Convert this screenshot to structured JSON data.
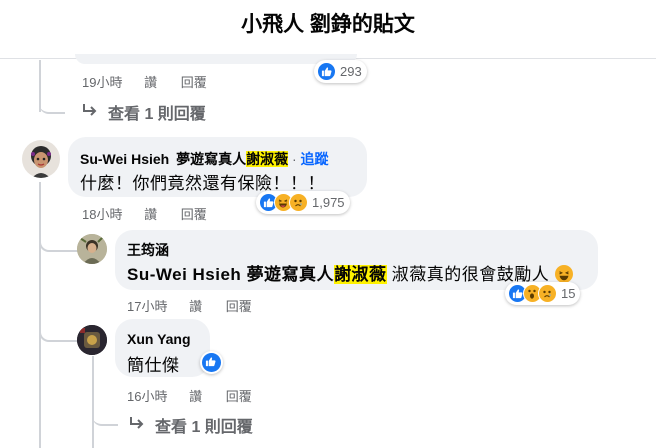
{
  "header": {
    "title": "小飛人 劉錚的貼文"
  },
  "comments": [
    {
      "time": "19小時",
      "like_label": "讚",
      "reply_label": "回覆",
      "reaction_count": "293",
      "view_replies": "查看 1 則回覆"
    },
    {
      "author": "Su-Wei Hsieh",
      "mention_prefix": "夢遊寫真人",
      "mention_highlight": "謝淑薇",
      "separator": "·",
      "follow_label": "追蹤",
      "text": "什麼！你們竟然還有保險！！！",
      "time": "18小時",
      "like_label": "讚",
      "reply_label": "回覆",
      "reaction_count": "1,975"
    },
    {
      "author": "王筠涵",
      "mention_name": "Su-Wei Hsieh",
      "mention_prefix": "夢遊寫真人",
      "mention_highlight": "謝淑薇",
      "text": "淑薇真的很會鼓勵人",
      "time": "17小時",
      "like_label": "讚",
      "reply_label": "回覆",
      "reaction_count": "15"
    },
    {
      "author": "Xun Yang",
      "text": "簡仕傑",
      "time": "16小時",
      "like_label": "讚",
      "reply_label": "回覆",
      "view_replies": "查看 1 則回覆"
    }
  ],
  "icons": {
    "like": "like-icon",
    "haha": "haha-icon",
    "sad": "sad-icon",
    "wow": "wow-icon",
    "reply_arrow": "reply-arrow-icon"
  },
  "colors": {
    "link_blue": "#0866ff",
    "like_blue": "#1877f2",
    "meta_gray": "#65676b",
    "highlight": "#fff200"
  }
}
